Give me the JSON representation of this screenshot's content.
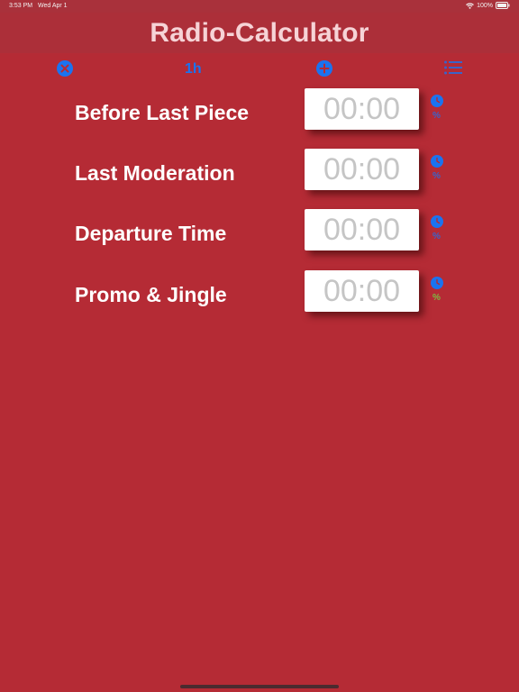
{
  "status": {
    "time": "3:53 PM",
    "date": "Wed Apr 1",
    "battery": "100%"
  },
  "header": {
    "title": "Radio-Calculator"
  },
  "toolbar": {
    "hour_label": "1h",
    "icons": [
      "close-circle-icon",
      "add-circle-icon",
      "list-icon"
    ]
  },
  "rows": [
    {
      "label": "Before Last Piece",
      "placeholder": "00:00",
      "percent": "%",
      "percent_color": "#3a63c9"
    },
    {
      "label": "Last Moderation",
      "placeholder": "00:00",
      "percent": "%",
      "percent_color": "#3a63c9"
    },
    {
      "label": "Departure Time",
      "placeholder": "00:00",
      "percent": "%",
      "percent_color": "#3a63c9"
    },
    {
      "label": "Promo & Jingle",
      "placeholder": "00:00",
      "percent": "%",
      "percent_color": "#7dbb42"
    }
  ],
  "colors": {
    "background": "#b52b35",
    "header": "#ac2f39",
    "accent": "#1a73f0"
  }
}
